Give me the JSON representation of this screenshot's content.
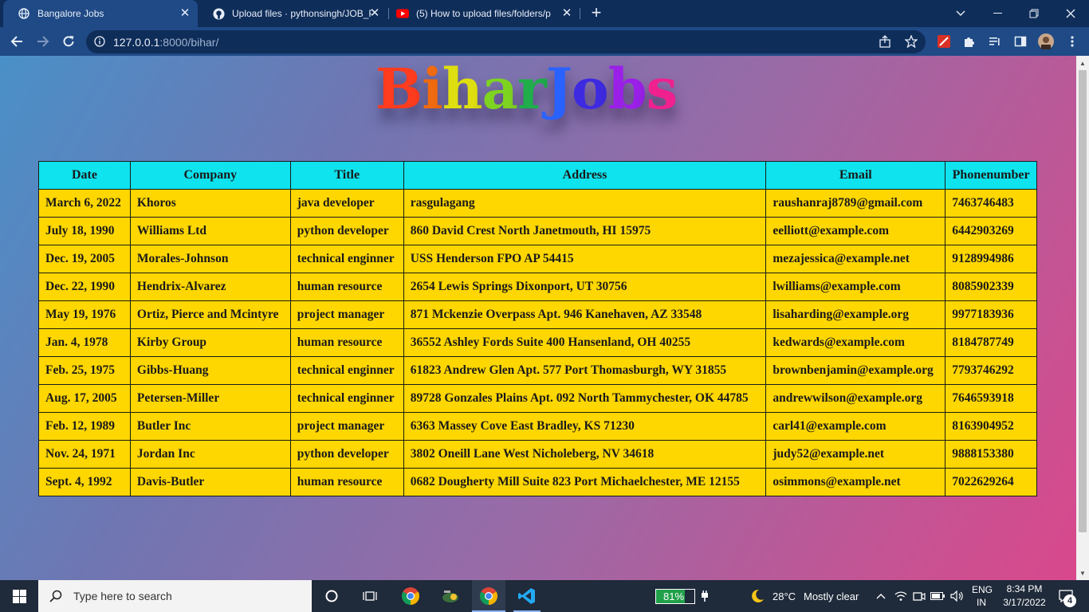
{
  "browser": {
    "tabs": [
      {
        "title": "Bangalore Jobs",
        "icon": "globe-icon",
        "active": true
      },
      {
        "title": "Upload files · pythonsingh/JOB_P",
        "icon": "github-icon",
        "active": false
      },
      {
        "title": "(5) How to upload files/folders/p",
        "icon": "youtube-icon",
        "active": false
      }
    ],
    "url_host": "127.0.0.1",
    "url_rest": ":8000/bihar/"
  },
  "page": {
    "brand_letters": [
      {
        "ch": "B",
        "color": "#ff3c1e"
      },
      {
        "ch": "i",
        "color": "#f06a10"
      },
      {
        "ch": "h",
        "color": "#dede10"
      },
      {
        "ch": "a",
        "color": "#7ed321"
      },
      {
        "ch": "r",
        "color": "#1fae4a"
      },
      {
        "ch": "J",
        "color": "#2a62ff"
      },
      {
        "ch": "o",
        "color": "#3e2ae0"
      },
      {
        "ch": "b",
        "color": "#9a20e8"
      },
      {
        "ch": "s",
        "color": "#f0208f"
      }
    ],
    "table": {
      "headers": [
        "Date",
        "Company",
        "Title",
        "Address",
        "Email",
        "Phonenumber"
      ],
      "rows": [
        [
          "March 6, 2022",
          "Khoros",
          "java developer",
          "rasgulagang",
          "raushanraj8789@gmail.com",
          "7463746483"
        ],
        [
          "July 18, 1990",
          "Williams Ltd",
          "python developer",
          "860 David Crest North Janetmouth, HI 15975",
          "eelliott@example.com",
          "6442903269"
        ],
        [
          "Dec. 19, 2005",
          "Morales-Johnson",
          "technical enginner",
          "USS Henderson FPO AP 54415",
          "mezajessica@example.net",
          "9128994986"
        ],
        [
          "Dec. 22, 1990",
          "Hendrix-Alvarez",
          "human resource",
          "2654 Lewis Springs Dixonport, UT 30756",
          "lwilliams@example.com",
          "8085902339"
        ],
        [
          "May 19, 1976",
          "Ortiz, Pierce and Mcintyre",
          "project manager",
          "871 Mckenzie Overpass Apt. 946 Kanehaven, AZ 33548",
          "lisaharding@example.org",
          "9977183936"
        ],
        [
          "Jan. 4, 1978",
          "Kirby Group",
          "human resource",
          "36552 Ashley Fords Suite 400 Hansenland, OH 40255",
          "kedwards@example.com",
          "8184787749"
        ],
        [
          "Feb. 25, 1975",
          "Gibbs-Huang",
          "technical enginner",
          "61823 Andrew Glen Apt. 577 Port Thomasburgh, WY 31855",
          "brownbenjamin@example.org",
          "7793746292"
        ],
        [
          "Aug. 17, 2005",
          "Petersen-Miller",
          "technical enginner",
          "89728 Gonzales Plains Apt. 092 North Tammychester, OK 44785",
          "andrewwilson@example.org",
          "7646593918"
        ],
        [
          "Feb. 12, 1989",
          "Butler Inc",
          "project manager",
          "6363 Massey Cove East Bradley, KS 71230",
          "carl41@example.com",
          "8163904952"
        ],
        [
          "Nov. 24, 1971",
          "Jordan Inc",
          "python developer",
          "3802 Oneill Lane West Nicholeberg, NV 34618",
          "judy52@example.net",
          "9888153380"
        ],
        [
          "Sept. 4, 1992",
          "Davis-Butler",
          "human resource",
          "0682 Dougherty Mill Suite 823 Port Michaelchester, ME 12155",
          "osimmons@example.net",
          "7022629264"
        ]
      ]
    }
  },
  "taskbar": {
    "search_placeholder": "Type here to search",
    "battery": "81%",
    "weather_temp": "28°C",
    "weather_desc": "Mostly clear",
    "lang_top": "ENG",
    "lang_bottom": "IN",
    "time": "8:34 PM",
    "date": "3/17/2022",
    "notifications": "4"
  }
}
